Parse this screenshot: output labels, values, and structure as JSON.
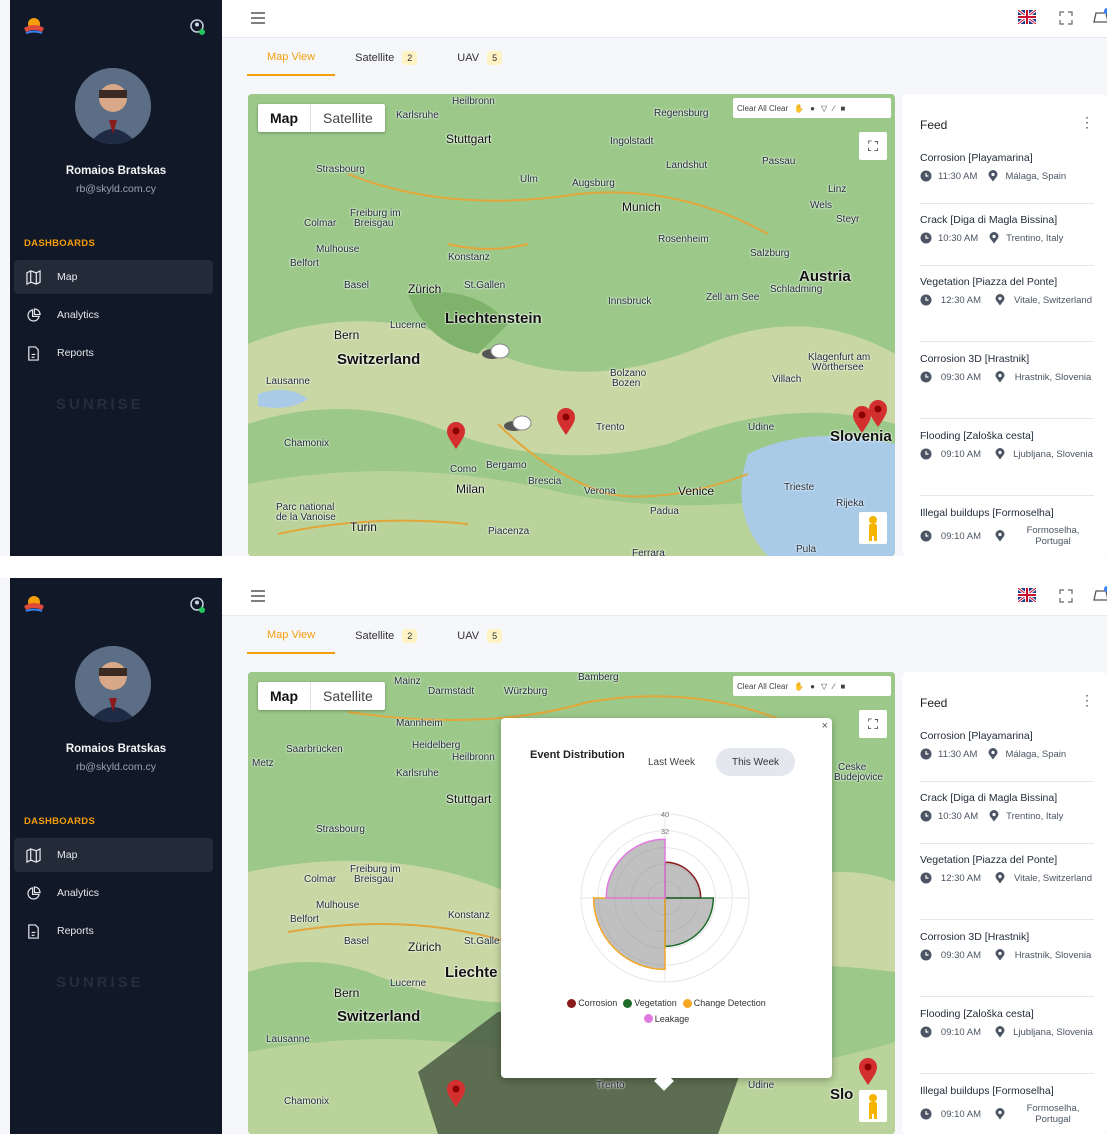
{
  "app": {
    "user": {
      "name": "Romaios Bratskas",
      "email": "rb@skyld.com.cy"
    },
    "section_label": "DASHBOARDS",
    "nav": [
      {
        "label": "Map",
        "icon": "map-icon",
        "active": true
      },
      {
        "label": "Analytics",
        "icon": "analytics-icon",
        "active": false
      },
      {
        "label": "Reports",
        "icon": "reports-icon",
        "active": false
      }
    ],
    "watermark": "SUNRISE",
    "colors": {
      "sidebar": "#111827",
      "accent": "#f59e0b",
      "badge": "#fdf3c4"
    }
  },
  "tabs": [
    {
      "label": "Map View",
      "badge": ""
    },
    {
      "label": "Satellite",
      "badge": "2"
    },
    {
      "label": "UAV",
      "badge": "5"
    }
  ],
  "map": {
    "type_buttons": [
      "Map",
      "Satellite"
    ],
    "toolbar_text": "Clear All Clear",
    "labels_panel1": [
      "Heilbronn",
      "Regensburg",
      "Karlsruhe",
      "Stuttgart",
      "Ingolstadt",
      "Landshut",
      "Passau",
      "Strasbourg",
      "Ulm",
      "Augsburg",
      "Munich",
      "Linz",
      "Wels",
      "Steyr",
      "Freiburg im Breisgau",
      "Colmar",
      "Mulhouse",
      "Konstanz",
      "Rosenheim",
      "Salzburg",
      "Austria",
      "Basel",
      "Zürich",
      "St.Gallen",
      "Belfort",
      "Innsbruck",
      "Zell am See",
      "Schladming",
      "Liechtenstein",
      "Lucerne",
      "Bern",
      "Switzerland",
      "Lausanne",
      "Klagenfurt am Wörthersee",
      "Villach",
      "Bolzano Bozen",
      "Trento",
      "Udine",
      "Slovenia",
      "Chamonix",
      "Como",
      "Bergamo",
      "Milan",
      "Brescia",
      "Verona",
      "Venice",
      "Trieste",
      "Padua",
      "Rijeka",
      "Turin",
      "Piacenza",
      "Pula",
      "Ferrara",
      "Parc national de la Vanoise"
    ],
    "labels_panel2": [
      "Bamberg",
      "Mainz",
      "Darmstadt",
      "Würzburg",
      "Mannheim",
      "Saarbrücken",
      "Heidelberg",
      "Heilbronn",
      "Metz",
      "Karlsruhe",
      "Stuttgart",
      "Strasbourg",
      "Ceske Budejovice",
      "Freiburg im Breisgau",
      "Colmar",
      "Mulhouse",
      "Belfort",
      "Konstanz",
      "Basel",
      "Zürich",
      "St.Galle",
      "Liechte",
      "Lucerne",
      "Bern",
      "Switzerland",
      "Lausanne",
      "Chamonix",
      "Udine",
      "Slo",
      "Trento"
    ]
  },
  "feed": {
    "title": "Feed",
    "items": [
      {
        "title": "Corrosion [Playamarina]",
        "time": "11:30 AM",
        "location": "Málaga, Spain"
      },
      {
        "title": "Crack [Diga di Magla Bissina]",
        "time": "10:30 AM",
        "location": "Trentino, Italy"
      },
      {
        "title": "Vegetation [Piazza del Ponte]",
        "time": "12:30 AM",
        "location": "Vitale, Switzerland"
      },
      {
        "title": "Corrosion 3D [Hrastnik]",
        "time": "09:30 AM",
        "location": "Hrastnik, Slovenia"
      },
      {
        "title": "Flooding [Zaloška cesta]",
        "time": "09:10 AM",
        "location": "Ljubljana, Slovenia"
      },
      {
        "title": "Illegal buildups [Formoselha]",
        "time": "09:10 AM",
        "location": "Formoselha, Portugal"
      }
    ]
  },
  "popup": {
    "title": "Event Distribution",
    "filters": [
      {
        "label": "Last Week",
        "active": false
      },
      {
        "label": "This Week",
        "active": true
      }
    ],
    "close_label": "×"
  },
  "chart_data": {
    "type": "polar-area",
    "title": "Event Distribution",
    "categories": [
      "Corrosion",
      "Vegetation",
      "Change Detection",
      "Leakage"
    ],
    "values": [
      17,
      23,
      34,
      28
    ],
    "colors": [
      "#8b1a1a",
      "#1e6b2a",
      "#f5a623",
      "#e07ae0"
    ],
    "r_ticks": [
      32,
      40
    ],
    "rlim": [
      0,
      40
    ],
    "legend": "bottom"
  }
}
